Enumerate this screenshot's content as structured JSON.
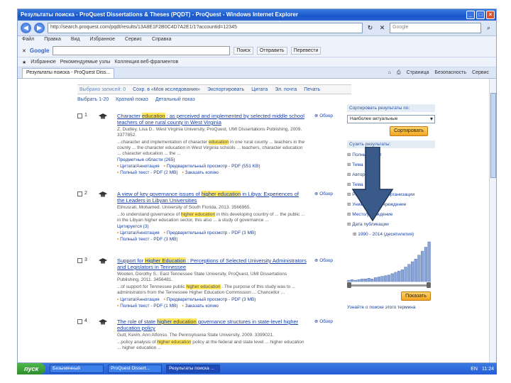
{
  "window": {
    "title": "Результаты поиска - ProQuest Dissertations & Theses (PQDT) - ProQuest - Windows Internet Explorer"
  },
  "address": {
    "url": "http://search.proquest.com/pqdt/results/13A8E1F2B0C4D7A2E1/1?accountid=12345",
    "search_placeholder": "Google"
  },
  "menu": {
    "items": [
      "Файл",
      "Правка",
      "Вид",
      "Избранное",
      "Сервис",
      "Справка"
    ]
  },
  "google_bar": {
    "logo": "Google",
    "search_btn": "Поиск",
    "share_btn": "Отправить",
    "translate_btn": "Перевести"
  },
  "favorites": {
    "label": "Избранное",
    "items": [
      "Рекомендуемые узлы",
      "Коллекция веб-фрагментов"
    ]
  },
  "tab": {
    "label": "Результаты поиска - ProQuest Diss..."
  },
  "tab_tools": {
    "items": [
      "Страница",
      "Безопасность",
      "Сервис"
    ]
  },
  "results": {
    "action_bar": {
      "selected": "Выбрано записей: 0",
      "items": [
        "Сохр. в «Моя исследования»",
        "Экспортировать",
        "Цитата",
        "Эл. почта",
        "Печать"
      ]
    },
    "tools": {
      "select": "Выбрать 1-20",
      "brief": "Краткий показ",
      "detailed": "Детальный показ"
    },
    "records": [
      {
        "num": "1",
        "title_a": "Character",
        "title_hl": "education",
        "title_b": ": as perceived and implemented by selected middle school teachers of one rural county in West Virginia",
        "meta": "Z. Dudley, Lisa D.. West Virginia University, ProQuest, UMI Dissertations Publishing, 2009. 3377852.",
        "abs_a": "...character and implementation of character",
        "abs_hl": "education",
        "abs_b": "in one rural county ... teachers in the county ... the character education in West Virginia schools ... teachers, character education ... character education ... the ...",
        "links": [
          "Цитата/Аннотация",
          "Предварительный просмотр - PDF (551 KB)"
        ],
        "links2": [
          "Полный текст - PDF (2 MB)",
          "Заказать копию"
        ],
        "subject": "Предметные области (265)",
        "ff": "⊕ Обзор"
      },
      {
        "num": "2",
        "title_a": "A view of key governance issues of",
        "title_hl": "higher education",
        "title_b": "in Libya: Experiences of the Leaders in Libyan Universities",
        "meta": "Elmusrati, Mohamed. University of South Florida, 2013. 3566965.",
        "abs_a": "...to understand governance of",
        "abs_hl": "higher education",
        "abs_b": "in this developing country of ... the public ... in the Libyan higher education sector, this also ... a study of governance ...",
        "links": [
          "Цитата/Аннотация",
          "Предварительный просмотр - PDF (3 MB)"
        ],
        "links2": [
          "Полный текст - PDF (3 MB)"
        ],
        "subject": "Цитируется (3)",
        "ff": "⊕ Обзор"
      },
      {
        "num": "3",
        "title_a": "Support for",
        "title_hl": "Higher Education",
        "title_b": ": Perceptions of Selected University Administrators and Legislators in Tennessee",
        "meta": "Wooten, Dorothy S.. East Tennessee State University, ProQuest, UMI Dissertations Publishing, 2011. 3456481.",
        "abs_a": "...of support for Tennessee public",
        "abs_hl": "higher education",
        "abs_b": ". The purpose of this study was to ... administrators from the Tennessee Higher Education Commission ... Chancellor ...",
        "links": [
          "Цитата/Аннотация",
          "Предварительный просмотр - PDF (3 MB)"
        ],
        "links2": [
          "Полный текст - PDF (1 MB)",
          "Заказать копию"
        ],
        "subject": "",
        "ff": "⊕ Обзор"
      },
      {
        "num": "4",
        "title_a": "The role of state",
        "title_hl": "higher education",
        "title_b": "governance structures in state-level higher education policy",
        "meta": "Gutt, Kevin, Ann Alfonso. The Pennsylvania State University, 2009. 3399021.",
        "abs_a": "...policy analysis of",
        "abs_hl": "higher education",
        "abs_b": "policy at the federal and state level ... higher education ... higher education ...",
        "links": [],
        "links2": [],
        "subject": "",
        "ff": "⊕ Обзор"
      }
    ]
  },
  "sidebar": {
    "sort_header": "Сортировать результаты по:",
    "sort_value": "Наиболее актуальные",
    "sort_button": "Сортировать",
    "narrow_header": "Сузить результаты:",
    "facets": [
      "Полный текст",
      "Тема",
      "Автор",
      "Тема",
      "Рецензируемые организации",
      "Университет/учреждение",
      "Место/учреждение",
      "Дата публикации"
    ],
    "date_range": "1990 - 2014 (десятилетия)",
    "hist": [
      2,
      3,
      2,
      3,
      4,
      4,
      5,
      4,
      6,
      7,
      8,
      9,
      10,
      12,
      14,
      16,
      18,
      22,
      26,
      30,
      34,
      40,
      46,
      52,
      60
    ],
    "show_button": "Показать",
    "footer": "Узнайте о поиске этого термина"
  },
  "taskbar": {
    "start": "пуск",
    "items": [
      "Безымянный",
      "ProQuest Dissert...",
      "Результаты поиска ..."
    ],
    "lang": "EN",
    "clock": "11:24"
  },
  "colors": {
    "accent": "#1a3fa0",
    "highlight": "#ffe65a",
    "arrow": "#3a5a8a"
  }
}
